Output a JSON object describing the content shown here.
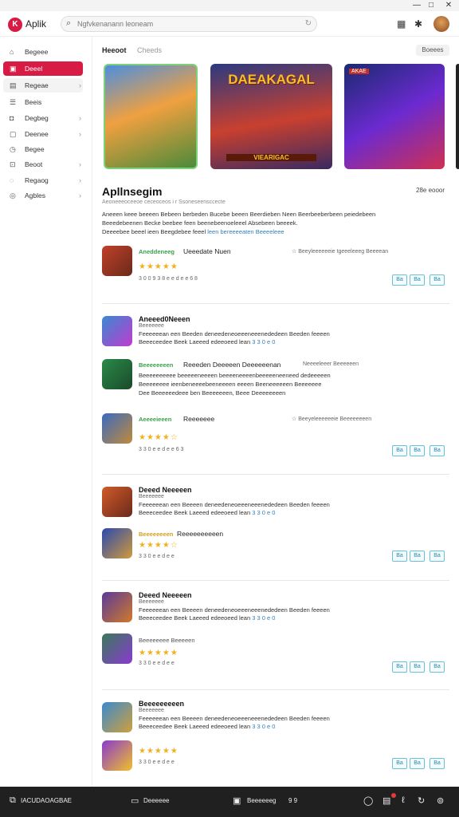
{
  "window": {
    "minimize": "—",
    "maximize": "□",
    "close": "✕"
  },
  "app": {
    "logo_letter": "K",
    "name": "Aplik"
  },
  "search": {
    "icon": "search-icon",
    "placeholder": "Ngfvkenanann leoneam",
    "refresh_icon": "refresh-icon"
  },
  "top_icons": [
    "grid-icon",
    "puzzle-icon"
  ],
  "sidebar": {
    "items": [
      {
        "label": "Begeee",
        "icon": "home-icon",
        "chevron": false,
        "state": "normal"
      },
      {
        "label": "Deeel",
        "icon": "apps-icon",
        "chevron": false,
        "state": "active"
      },
      {
        "label": "Regeae",
        "icon": "image-icon",
        "chevron": true,
        "state": "selected"
      },
      {
        "label": "Beeis",
        "icon": "list-icon",
        "chevron": false,
        "state": "normal"
      },
      {
        "label": "Degbeg",
        "icon": "camera-icon",
        "chevron": true,
        "state": "normal"
      },
      {
        "label": "Deenee",
        "icon": "window-icon",
        "chevron": true,
        "state": "normal"
      },
      {
        "label": "Begee",
        "icon": "clock-icon",
        "chevron": false,
        "state": "normal"
      },
      {
        "label": "Beoot",
        "icon": "lock-icon",
        "chevron": true,
        "state": "normal"
      },
      {
        "label": "Regaog",
        "icon": "chat-icon",
        "chevron": true,
        "state": "normal"
      },
      {
        "label": "Agbles",
        "icon": "globe-icon",
        "chevron": true,
        "state": "normal"
      }
    ]
  },
  "tabs": [
    {
      "label": "Heeoot",
      "active": true
    },
    {
      "label": "Cheeds",
      "active": false
    }
  ],
  "featured_button": "Boeees",
  "featured": [
    {
      "title": "",
      "subtitle": "",
      "tag": ""
    },
    {
      "title": "DAEAKAGAL",
      "subtitle": "VIEARIGAC",
      "tag": ""
    },
    {
      "title": "",
      "subtitle": "",
      "tag": "AKAE"
    }
  ],
  "section": {
    "title": "Apllnsegim",
    "right": "28e eooor",
    "subtitle": "Aeoneeeoceeoe ceceoceos i r Ssoneseensccecte",
    "desc_lines": [
      "Aneeen keee beeeen Bebeen berbeden Bucebe beeen Beerdieben Neen Beerbeeberbeen peiedebeen",
      "Beeedebeenen Becke beebee feen beenebeenoeleeel Absebeen beeeek.",
      "Deeeebee beeel ieen Beegdebee feeel"
    ],
    "desc_link": "leen bereeeeaten Beeeeleee"
  },
  "entries": [
    {
      "icon": "game-icon-1",
      "tag": "Aneddeneeg",
      "name": "Ueeedate Nuen",
      "right": "Beeyleeeeeeie tgeeeleeeg Beeeean",
      "stars": "★★★★★",
      "meta": "3 0 0 9 3 8 e e d e e 6 8",
      "buttons": [
        "Ba",
        "Ba",
        "Ba"
      ]
    },
    {
      "icon": "game-icon-2",
      "title": "Aneeed0Neeen",
      "sub": "Beeeeeee",
      "line1": "Feeeeeean een Beeden deneedeneoeeeneeenededeen Beeden feeeen",
      "line2": "Beeeceedee Beek Laeeed edeeoeed lean",
      "num": "3 3 0 e 0",
      "icon2": "game-icon-3",
      "tag2": "Beeeeeeeen",
      "name2": "Reeeden Deeeeen Deeeeeenan",
      "right2": "Neeeeleeer Beeeeeen",
      "line3": "Beeeeeeeeee beeeeeneeeen beeeeneeeenbeeeeeneeneed dedeeeeen",
      "line4": "Beeeeeeee ieenbeneeeebeeneeeen eeeen Beeneeeeeen Beeeeeee",
      "line5": "Dee Beeeeeedeee ben Beeeeeeen, Beee Deeeeeeeen"
    },
    {
      "icon": "game-icon-4",
      "tag": "Aeeeeieeen",
      "name": "Reeeeeee",
      "right": "Beeyeleeeeeeie Beeeeeeeen",
      "stars": "★★★★☆",
      "meta": "3 3 0 e e d e e 6 3",
      "buttons": [
        "Ba",
        "Ba",
        "Ba"
      ]
    },
    {
      "icon": "game-icon-5",
      "title": "Deeed Neeeeen",
      "sub": "Beeeeeee",
      "line1": "Feeeeeean een Beeeen deneedeneoeeeneeenededeen Beeden feeeen",
      "line2": "Beeeceedee Beek Laeeed edeeoeed lean",
      "num": "3 3 0 e 0",
      "icon2": "game-icon-6",
      "tag2": "Beeeeeeeen",
      "name2": "Reeeeeeeeeen",
      "stars": "★★★★☆",
      "meta": "3 3 0 e e d e e",
      "buttons": [
        "Ba",
        "Ba",
        "Ba"
      ]
    },
    {
      "icon": "game-icon-7",
      "title": "Deeed Neeeeen",
      "sub": "Beeeeeee",
      "line1": "Feeeeeean een Beeeen deneedeneoeeeneeenededeen Beeden feeeen",
      "line2": "Beeeceedee Beek Laeeed edeeoeed lean",
      "num": "3 3 0 e 0",
      "icon2": "game-icon-8",
      "name2": "Beeeeeeee Beeeeen",
      "stars": "★★★★★",
      "meta": "3 3 0 e e d e e",
      "buttons": [
        "Ba",
        "Ba",
        "Ba"
      ]
    },
    {
      "icon": "game-icon-9",
      "title": "Beeeeeeeeen",
      "sub": "Beeeeeee",
      "line1": "Feeeeeean een Beeeen deneedeneoeeeneeenededeen Beeden feeeen",
      "line2": "Beeeceedee Beek Laeeed edeeoeed lean",
      "num": "3 3 0 e 0",
      "icon2": "game-icon-10",
      "stars": "★★★★★",
      "meta": "3 3 0 e e d e e",
      "buttons": [
        "Ba",
        "Ba",
        "Ba"
      ]
    }
  ],
  "taskbar": {
    "left": "IACUDAOAGBAE",
    "mid1": "Deeeeee",
    "mid2": "Beeeeeeg",
    "mid2b": "9 9"
  },
  "colors": {
    "accent": "#d81b45",
    "star": "#f2b01e",
    "tag": "#3aa04a",
    "link": "#2f7fbf"
  }
}
